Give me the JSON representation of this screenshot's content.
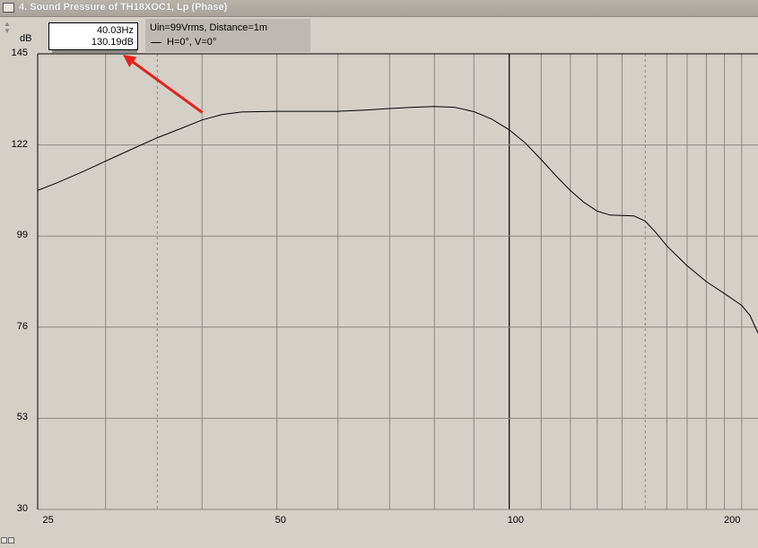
{
  "window": {
    "title": "4. Sound Pressure of TH18XOC1, Lp (Phase)"
  },
  "chart_data": {
    "type": "line",
    "x_scale": "log",
    "xlim": [
      24.5,
      210
    ],
    "ylim": [
      30,
      145
    ],
    "ylabel": "dB",
    "yticks": [
      "145",
      "122",
      "99",
      "76",
      "53",
      "30"
    ],
    "xticks": [
      "25",
      "50",
      "100",
      "200"
    ],
    "grid": true,
    "legend_placement": "top-left",
    "info_text": "Uin=99Vrms, Distance=1m",
    "series": [
      {
        "name": "H=0°, V=0°",
        "color": "#000000",
        "x": [
          24.5,
          26,
          28,
          30,
          32.5,
          35,
          37.5,
          40,
          42.5,
          45,
          50,
          55,
          60,
          65,
          70,
          75,
          80,
          85,
          90,
          95,
          100,
          105,
          110,
          115,
          120,
          125,
          130,
          135,
          140,
          145,
          150,
          155,
          160,
          170,
          180,
          190,
          200,
          205,
          210
        ],
        "values": [
          110.5,
          112.5,
          115.2,
          117.9,
          121,
          123.8,
          126.1,
          128.3,
          129.7,
          130.3,
          130.5,
          130.5,
          130.5,
          130.8,
          131.2,
          131.5,
          131.7,
          131.5,
          130.4,
          128.5,
          125.8,
          122.4,
          118.3,
          114.2,
          110.5,
          107.5,
          105.3,
          104.3,
          104.2,
          104.1,
          102.8,
          99.8,
          96.5,
          91.5,
          87.5,
          84.5,
          81.5,
          79,
          74.5
        ]
      }
    ]
  },
  "cursor": {
    "freq_label": "40.03Hz",
    "level_label": "130.19dB",
    "x": 40.03,
    "y": 130.19,
    "arrow_color": "#e8211a"
  }
}
